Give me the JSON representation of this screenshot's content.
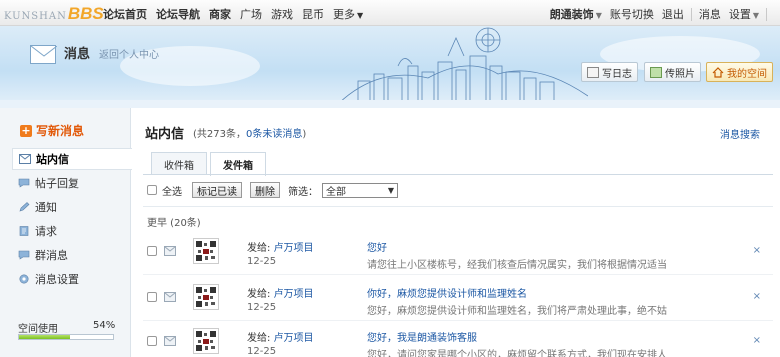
{
  "topbar": {
    "logo_text": "KUNSHAN",
    "logo_bbs": "BBS",
    "nav": [
      "论坛首页",
      "论坛导航",
      "商家",
      "广场",
      "游戏",
      "昆币",
      "更多"
    ],
    "user": "朗通装饰",
    "switch_account": "账号切换",
    "logout": "退出",
    "messages": "消息",
    "settings": "设置"
  },
  "banner": {
    "title": "消息",
    "subtitle": "返回个人中心",
    "buttons": [
      "写日志",
      "传照片",
      "我的空间"
    ]
  },
  "sidebar": {
    "compose": "写新消息",
    "items": [
      "站内信",
      "帖子回复",
      "通知",
      "请求",
      "群消息",
      "消息设置"
    ],
    "space_label": "空间使用",
    "space_percent": "54%",
    "space_fraction": 0.54
  },
  "main": {
    "title": "站内信",
    "count_text": "(共273条，",
    "unread_text": "0条未读消息",
    "count_close": ")",
    "search_link": "消息搜索",
    "tabs": [
      "收件箱",
      "发件箱"
    ],
    "toolbar": {
      "select_all": "全选",
      "mark_read": "标记已读",
      "delete": "删除",
      "filter_label": "筛选：",
      "filter_value": "全部"
    },
    "group_label": "更早 (20条)",
    "messages": [
      {
        "sender_prefix": "发给:",
        "sender": "卢万项目",
        "date": "12-25",
        "subject": "您好",
        "preview": "请您往上小区楼栋号，经我们核查后情况属实，我们将根据情况适当..."
      },
      {
        "sender_prefix": "发给:",
        "sender": "卢万项目",
        "date": "12-25",
        "subject": "你好，麻烦您提供设计师和监理姓名",
        "preview": "您好，麻烦您提供设计师和监理姓名，我们将严肃处理此事，绝不姑..."
      },
      {
        "sender_prefix": "发给:",
        "sender": "卢万项目",
        "date": "12-25",
        "subject": "您好，我是朗通装饰客服",
        "preview": "您好，请问您家是哪个小区的，麻烦留个联系方式，我们现在安排人..."
      }
    ],
    "delete_icon": "×"
  },
  "colors": {
    "accent_blue": "#1d58a4",
    "compose_orange": "#e25a0b",
    "space_green": "#7cc221"
  }
}
